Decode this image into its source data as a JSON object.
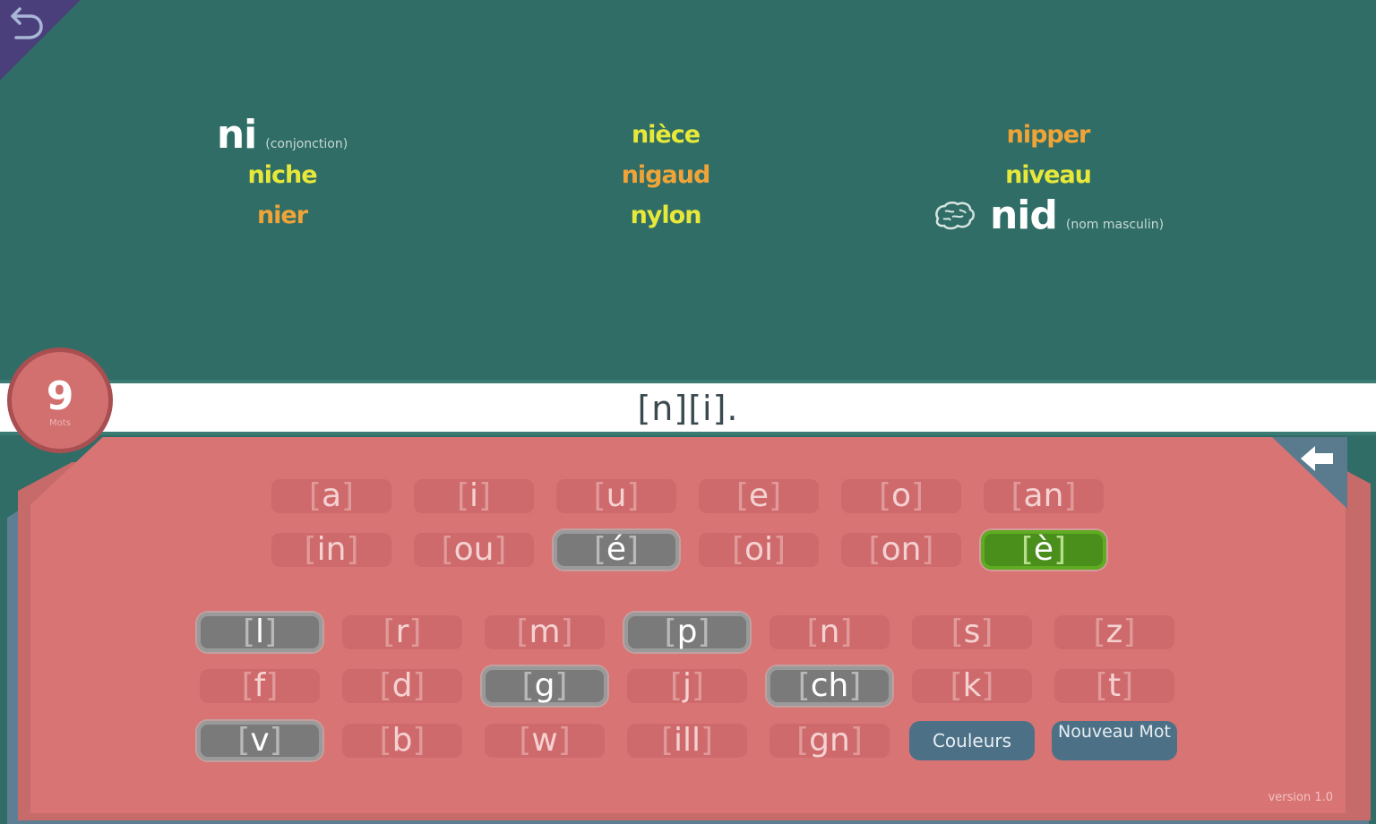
{
  "nav": {
    "back_icon": "undo-arrow-icon"
  },
  "words": {
    "col1": [
      {
        "text": "ni",
        "note": "(conjonction)",
        "style": "big"
      },
      {
        "text": "niche",
        "style": "yellow"
      },
      {
        "text": "nier",
        "style": "orange"
      }
    ],
    "col2": [
      {
        "text": "nièce",
        "style": "yellow"
      },
      {
        "text": "nigaud",
        "style": "orange"
      },
      {
        "text": "nylon",
        "style": "yellow"
      }
    ],
    "col3": [
      {
        "text": "nipper",
        "style": "orange"
      },
      {
        "text": "niveau",
        "style": "yellow"
      },
      {
        "text": "nid",
        "note": "(nom masculin)",
        "style": "big",
        "icon": "brain-icon"
      }
    ]
  },
  "phonetic": {
    "text": "[n][i]."
  },
  "counter": {
    "value": "9",
    "sub": "Mots"
  },
  "keyboard": {
    "vowels_row1": [
      "a",
      "i",
      "u",
      "e",
      "o",
      "an"
    ],
    "vowels_row2": [
      "in",
      "ou",
      "é",
      "oi",
      "on",
      "è"
    ],
    "cons_row1": [
      "l",
      "r",
      "m",
      "p",
      "n",
      "s",
      "z"
    ],
    "cons_row2": [
      "f",
      "d",
      "g",
      "j",
      "ch",
      "k",
      "t"
    ],
    "cons_row3": [
      "v",
      "b",
      "w",
      "ill",
      "gn"
    ],
    "couleurs": "Couleurs",
    "nouveau_mot": "Nouveau Mot",
    "back_icon": "backspace-arrow-icon",
    "highlighted_gray": [
      "é",
      "l",
      "p",
      "g",
      "ch",
      "v"
    ],
    "highlighted_green": [
      "è"
    ]
  },
  "colors": {
    "background": "#2f6d66",
    "panel": "#d87474",
    "word_yellow": "#e8e83a",
    "word_orange": "#f0a438",
    "key_selected_green": "#4a8e1c"
  },
  "footer": {
    "version": "version 1.0"
  }
}
